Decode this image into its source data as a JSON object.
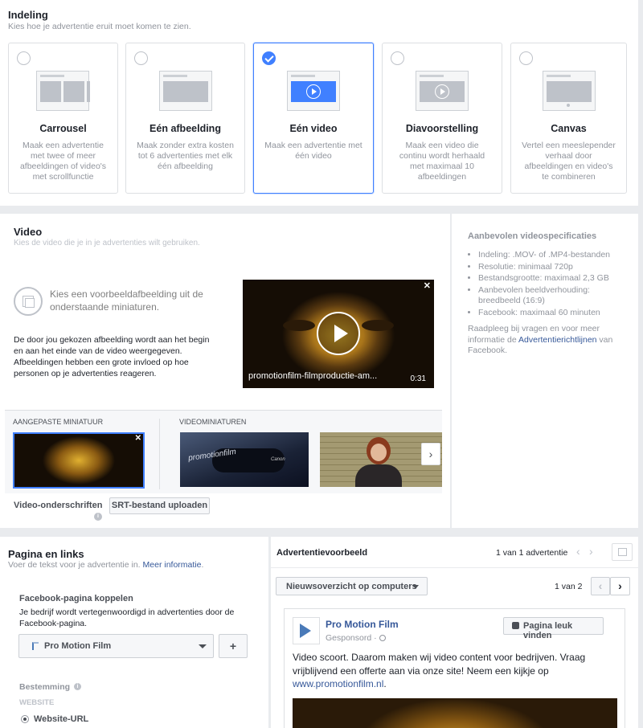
{
  "layout": {
    "title": "Indeling",
    "subtitle": "Kies hoe je advertentie eruit moet komen te zien.",
    "options": [
      {
        "title": "Carrousel",
        "desc": "Maak een advertentie met twee of meer afbeeldingen of video's met scrollfunctie",
        "selected": false
      },
      {
        "title": "Eén afbeelding",
        "desc": "Maak zonder extra kosten tot 6 advertenties met elk één afbeelding",
        "selected": false
      },
      {
        "title": "Eén video",
        "desc": "Maak een advertentie met één video",
        "selected": true
      },
      {
        "title": "Diavoorstelling",
        "desc": "Maak een video die continu wordt herhaald met maximaal 10 afbeeldingen",
        "selected": false
      },
      {
        "title": "Canvas",
        "desc": "Vertel een meeslepender verhaal door afbeeldingen en video's te combineren",
        "selected": false
      }
    ]
  },
  "video": {
    "title": "Video",
    "subtitle": "Kies de video die je in je advertenties wilt gebruiken.",
    "thumb_prompt": "Kies een voorbeeldafbeelding uit de onderstaande miniaturen.",
    "thumb_info": "De door jou gekozen afbeelding wordt aan het begin en aan het einde van de video weergegeven. Afbeeldingen hebben een grote invloed op hoe personen op je advertenties reageren.",
    "filename": "promotionfilm-filmproductie-am...",
    "duration": "0:31",
    "custom_thumb_label": "AANGEPASTE MINIATUUR",
    "video_thumbs_label": "VIDEOMINIATUREN",
    "captions_label": "Video-onderschriften",
    "srt_button": "SRT-bestand uploaden",
    "thumb_brand": "promotionfilm",
    "camera_brand": "Canon"
  },
  "specs": {
    "title": "Aanbevolen videospecificaties",
    "items": [
      "Indeling: .MOV- of .MP4-bestanden",
      "Resolutie: minimaal 720p",
      "Bestandsgrootte: maximaal 2,3 GB",
      "Aanbevolen beeldverhouding: breedbeeld (16:9)",
      "Facebook: maximaal 60 minuten"
    ],
    "note_pre": "Raadpleeg bij vragen en voor meer informatie de ",
    "note_link": "Advertentierichtlijnen",
    "note_post": " van Facebook."
  },
  "page": {
    "title": "Pagina en links",
    "subtitle_pre": "Voer de tekst voor je advertentie in. ",
    "subtitle_link": "Meer informatie",
    "subtitle_end": ".",
    "fb_label": "Facebook-pagina koppelen",
    "fb_desc": "Je bedrijf wordt vertegenwoordigd in advertenties door de Facebook-pagina.",
    "selected_page": "Pro Motion Film",
    "add_label": "+",
    "dest_label": "Bestemming",
    "website_label": "WEBSITE",
    "website_radio": "Website-URL"
  },
  "preview": {
    "title": "Advertentievoorbeeld",
    "count": "1 van 1 advertentie",
    "placement": "Nieuwsoverzicht op computers",
    "page_count": "1 van 2",
    "page_name": "Pro Motion Film",
    "sponsored": "Gesponsord · ",
    "like_button": "Pagina leuk vinden",
    "text": "Video scoort. Daarom maken wij video content voor bedrijven. Vraag vrijblijvend een offerte aan via onze site! Neem een kijkje op ",
    "link": "www.promotionfilm.nl",
    "link_end": "."
  },
  "colors": {
    "accent": "#4080ff",
    "link": "#365899",
    "bg": "#e9ebee"
  }
}
